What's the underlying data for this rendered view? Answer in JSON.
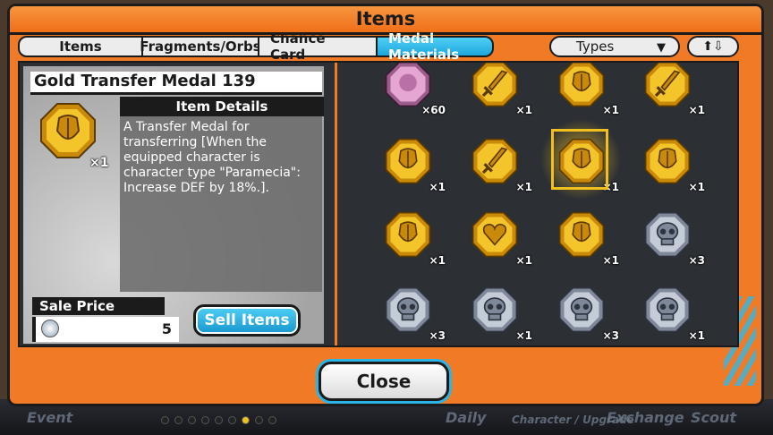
{
  "window": {
    "title": "Items"
  },
  "tabs": [
    {
      "label": "Items",
      "active": false
    },
    {
      "label": "Fragments/Orbs",
      "active": false
    },
    {
      "label": "Chance Card",
      "active": false
    },
    {
      "label": "Medal Materials",
      "active": true
    }
  ],
  "filter": {
    "label": "Types",
    "caret_icon": "chevron-down-icon"
  },
  "sort": {
    "icon": "sort-up-down-icon",
    "glyph": "⬆⇩"
  },
  "detail": {
    "name": "Gold Transfer Medal 139",
    "quantity": "×1",
    "details_heading": "Item Details",
    "description": "A Transfer Medal for transferring [When the equipped character is character type \"Paramecia\": Increase DEF by 18%.].",
    "sale_label": "Sale Price",
    "sale_value": "5",
    "sell_button": "Sell Items"
  },
  "grid": {
    "items": [
      {
        "kind": "pink",
        "qty": "×60"
      },
      {
        "kind": "gold-sword",
        "qty": "×1"
      },
      {
        "kind": "gold-armor",
        "qty": "×1"
      },
      {
        "kind": "gold-sword",
        "qty": "×1"
      },
      {
        "kind": "gold-armor",
        "qty": "×1"
      },
      {
        "kind": "gold-sword",
        "qty": "×1"
      },
      {
        "kind": "gold-armor",
        "qty": "×1",
        "selected": true
      },
      {
        "kind": "gold-armor",
        "qty": "×1"
      },
      {
        "kind": "gold-armor",
        "qty": "×1"
      },
      {
        "kind": "gold-heart",
        "qty": "×1"
      },
      {
        "kind": "gold-armor",
        "qty": "×1"
      },
      {
        "kind": "silver-skull",
        "qty": "×3"
      },
      {
        "kind": "silver-skull",
        "qty": "×3"
      },
      {
        "kind": "silver-skull",
        "qty": "×1"
      },
      {
        "kind": "silver-skull",
        "qty": "×3"
      },
      {
        "kind": "silver-skull",
        "qty": "×1"
      }
    ]
  },
  "close_button": "Close",
  "background_menu": [
    "Event",
    "Daily",
    "Character / Upgrade",
    "Exchange",
    "Scout"
  ],
  "colors": {
    "frame": "#f07a25",
    "accent": "#1ea6dc",
    "gold": "#f0c020",
    "panel": "#2c2f34"
  }
}
